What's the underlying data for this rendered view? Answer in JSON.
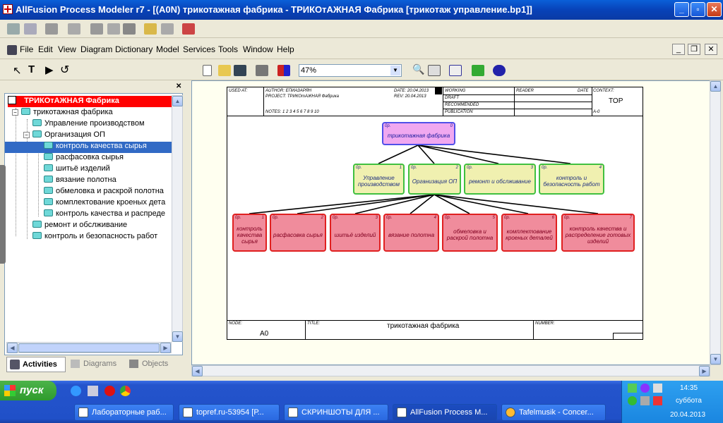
{
  "window": {
    "title": "AllFusion Process Modeler r7 - [(A0N) трикотажная фабрика - ТРИКОтАЖНАЯ Фабрика  [трикотаж управление.bp1]]"
  },
  "menu": [
    "File",
    "Edit",
    "View",
    "Diagram",
    "Dictionary",
    "Model",
    "Services",
    "Tools",
    "Window",
    "Help"
  ],
  "toolbar": {
    "zoom": "47%"
  },
  "tree": {
    "root": "ТРИКОтАЖНАЯ Фабрика",
    "items": [
      {
        "label": "трикотажная фабрика",
        "level": 1
      },
      {
        "label": "Управление  производством",
        "level": 2
      },
      {
        "label": "Организация ОП",
        "level": 2
      },
      {
        "label": "контроль  качества  сырья",
        "level": 3,
        "selected": true
      },
      {
        "label": "расфасовка сырья",
        "level": 3
      },
      {
        "label": "шитьё изделий",
        "level": 3
      },
      {
        "label": "вязание  полотна",
        "level": 3
      },
      {
        "label": "обмеловка и  раскрой полотна",
        "level": 3
      },
      {
        "label": "комплектование  кроеных дета",
        "level": 3
      },
      {
        "label": "контроль качества и  распреде",
        "level": 3
      },
      {
        "label": "ремонт и обслживание",
        "level": 2
      },
      {
        "label": "контроль и  безопасность работ",
        "level": 2
      }
    ],
    "tabs": [
      "Activities",
      "Diagrams",
      "Objects"
    ]
  },
  "frame": {
    "used_at": "USED AT:",
    "author": "AUTHOR:  ЕПИАЗАРЯН",
    "project": "PROJECT:  ТРИКОтАЖНАЯ Фабрика",
    "date": "DATE: 20.04.2013",
    "rev": "REV:   20.04.2013",
    "notes": "NOTES:  1  2  3  4  5  6  7  8  9  10",
    "status": [
      "WORKING",
      "DRAFT",
      "RECOMMENDED",
      "PUBLICATION"
    ],
    "reader": "READER",
    "date2": "DATE",
    "context": "CONTEXT:",
    "top": "TOP",
    "a0": "A-0",
    "node_label": "NODE:",
    "node": "A0",
    "title_label": "TITLE:",
    "title": "трикотажная фабрика",
    "number_label": "NUMBER:"
  },
  "diagram": {
    "top": {
      "num": "0р.",
      "idx": "0",
      "label": "трикотажная фабрика"
    },
    "level1": [
      {
        "num": "0р.",
        "idx": "1",
        "label": "Управление производством"
      },
      {
        "num": "0р.",
        "idx": "2",
        "label": "Организация ОП"
      },
      {
        "num": "0р.",
        "idx": "3",
        "label": "ремонт и обслживание"
      },
      {
        "num": "0р.",
        "idx": "4",
        "label": "контроль и безопасность работ"
      }
    ],
    "level2": [
      {
        "num": "0р.",
        "idx": "1",
        "label": "контроль качества сырья"
      },
      {
        "num": "0р.",
        "idx": "2",
        "label": "расфасовка сырья"
      },
      {
        "num": "0р.",
        "idx": "3",
        "label": "шитьё изделий"
      },
      {
        "num": "0р.",
        "idx": "4",
        "label": "вязание полотна"
      },
      {
        "num": "0р.",
        "idx": "5",
        "label": "обмеловка и раскрой полотна"
      },
      {
        "num": "0р.",
        "idx": "6",
        "label": "комплектование кроеных деталей"
      },
      {
        "num": "0р.",
        "idx": "7",
        "label": "контроль качества и распределение готовых изделий"
      }
    ]
  },
  "taskbar": {
    "start": "пуск",
    "tasks": [
      "Лабораторные раб...",
      "topref.ru-53954 [Р...",
      "СКРИНШОТЫ ДЛЯ ...",
      "AllFusion Process M...",
      "Tafelmusik - Concer..."
    ],
    "time": "14:35",
    "day": "суббота",
    "date": "20.04.2013"
  }
}
